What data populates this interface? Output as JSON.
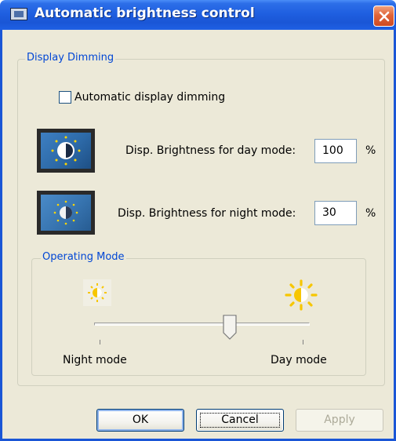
{
  "window": {
    "title": "Automatic brightness control",
    "icon": "app-icon"
  },
  "display_dimming": {
    "legend": "Display Dimming",
    "auto_dimming_label": "Automatic display dimming",
    "auto_dimming_checked": false,
    "day_mode": {
      "label": "Disp. Brightness for day mode:",
      "value": "100",
      "unit": "%"
    },
    "night_mode": {
      "label": "Disp. Brightness for night mode:",
      "value": "30",
      "unit": "%"
    }
  },
  "operating_mode": {
    "legend": "Operating Mode",
    "night_label": "Night mode",
    "day_label": "Day mode",
    "slider_level": 0.63,
    "icons": [
      "night-sun-icon",
      "day-sun-icon"
    ]
  },
  "buttons": {
    "ok": "OK",
    "cancel": "Cancel",
    "apply": "Apply"
  },
  "colors": {
    "titlebar": "#1f5fe0",
    "dialog_bg": "#ece9d8",
    "legend_text": "#0046d5",
    "sun_yellow": "#f7c600"
  }
}
